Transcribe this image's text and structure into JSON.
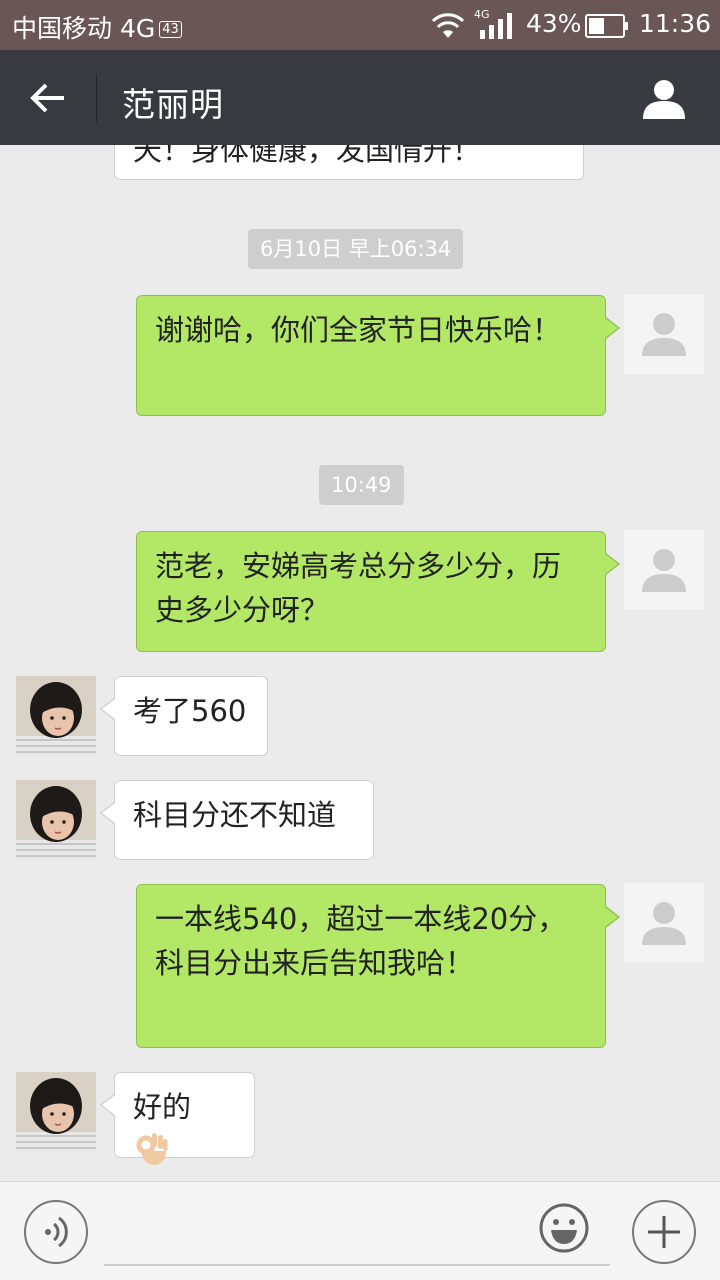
{
  "status_bar": {
    "carrier": "中国移动 4G",
    "carrier_badge": "43",
    "network": "4G",
    "battery_percent": "43%",
    "time": "11:36"
  },
  "header": {
    "title": "范丽明"
  },
  "chat": {
    "cut_message": "天！身体健康，发国情升！",
    "timestamps": [
      "6月10日 早上06:34",
      "10:49"
    ],
    "messages": [
      {
        "side": "out",
        "text": "谢谢哈，你们全家节日快乐哈！"
      },
      {
        "side": "out",
        "text": "范老，安娣高考总分多少分，历史多少分呀？"
      },
      {
        "side": "in",
        "text": "考了560"
      },
      {
        "side": "in",
        "text": "科目分还不知道"
      },
      {
        "side": "out",
        "text": "一本线540，超过一本线20分，科目分出来后告知我哈！"
      },
      {
        "side": "in",
        "text": "好的"
      }
    ]
  },
  "input_bar": {
    "value": ""
  },
  "icons": {
    "back": "back-arrow-icon",
    "profile": "person-icon",
    "voice": "voice-icon",
    "emoji": "emoji-icon",
    "plus": "plus-icon",
    "ok_hand": "ok-hand-emoji"
  },
  "colors": {
    "title_bar": "#393a3f",
    "status_bar": "#6b5656",
    "chat_background": "#ebebeb",
    "outgoing_bubble": "#b2e866",
    "incoming_bubble": "#ffffff"
  }
}
